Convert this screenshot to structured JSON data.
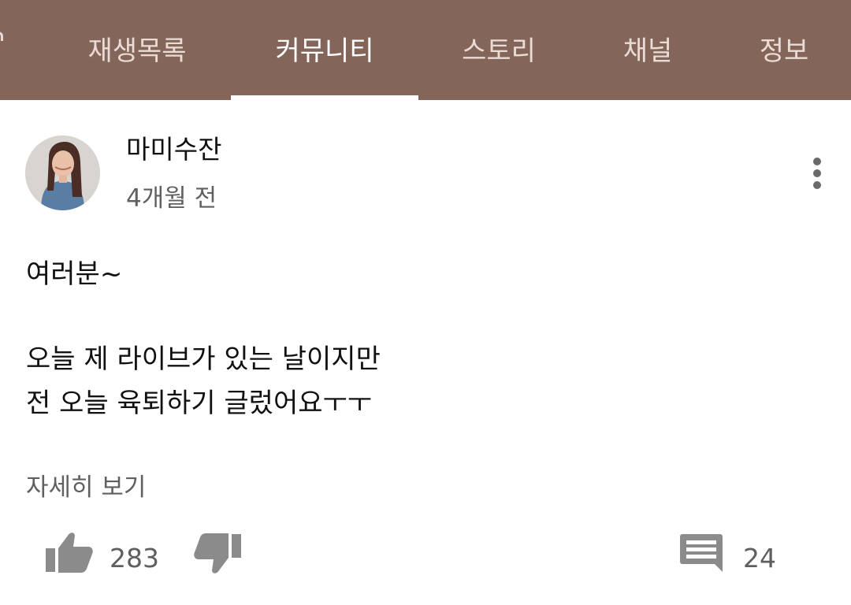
{
  "tabs": [
    {
      "label": "재생목록",
      "active": false
    },
    {
      "label": "커뮤니티",
      "active": true
    },
    {
      "label": "스토리",
      "active": false
    },
    {
      "label": "채널",
      "active": false
    },
    {
      "label": "정보",
      "active": false
    }
  ],
  "colors": {
    "tab_bar": "#84655a",
    "tab_text": "#eadbd4",
    "tab_active": "#ffffff",
    "icon_gray": "#8b8b8b"
  },
  "post": {
    "author": "마미수잔",
    "time": "4개월 전",
    "lines": [
      "여러분~",
      "오늘 제 라이브가 있는 날이지만",
      "전 오늘 육퇴하기 글렀어요ㅜㅜ"
    ],
    "read_more": "자세히 보기",
    "likes": "283",
    "comments": "24"
  },
  "icons": {
    "menu": "more-vert-icon",
    "like": "thumb-up-icon",
    "dislike": "thumb-down-icon",
    "comment": "comment-icon"
  }
}
